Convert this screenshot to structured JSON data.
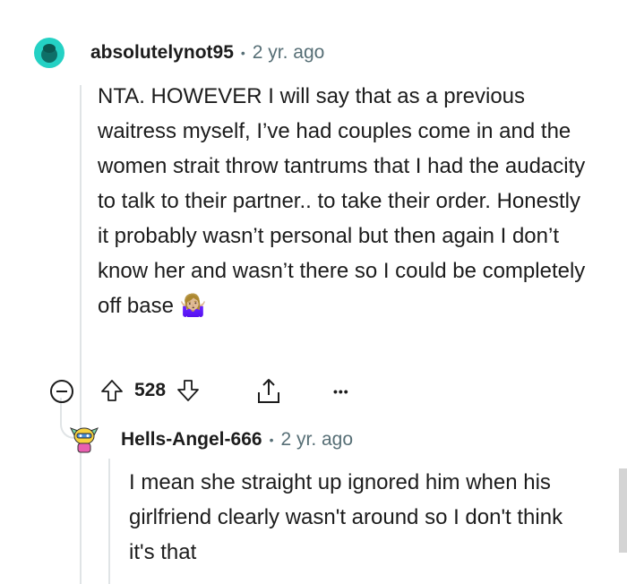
{
  "comment": {
    "username": "absolutelynot95",
    "separator": "•",
    "time": "2 yr. ago",
    "body": "NTA. HOWEVER I will say that as a previous waitress myself, I’ve had couples come in and the women strait throw tantrums that I had the audacity to talk to their partner.. to take their order. Honestly it probably wasn’t personal but then again I don’t know her and wasn’t there so I could be completely off base",
    "emoji": "🤷🏼‍♀️",
    "votes": "528",
    "more_label": "•••"
  },
  "reply": {
    "username": "Hells-Angel-666",
    "separator": "•",
    "time": "2 yr. ago",
    "body": "I mean she straight up ignored him when his girlfriend clearly wasn't around so I don't think it's that"
  },
  "colors": {
    "text": "#1c1c1c",
    "meta": "#576f76",
    "thread": "#e0e4e6",
    "avatar_teal": "#24d1c4"
  },
  "icons": {
    "collapse": "minus-circle-icon",
    "upvote": "arrow-up-icon",
    "downvote": "arrow-down-icon",
    "share": "share-icon",
    "more": "more-dots-icon"
  }
}
